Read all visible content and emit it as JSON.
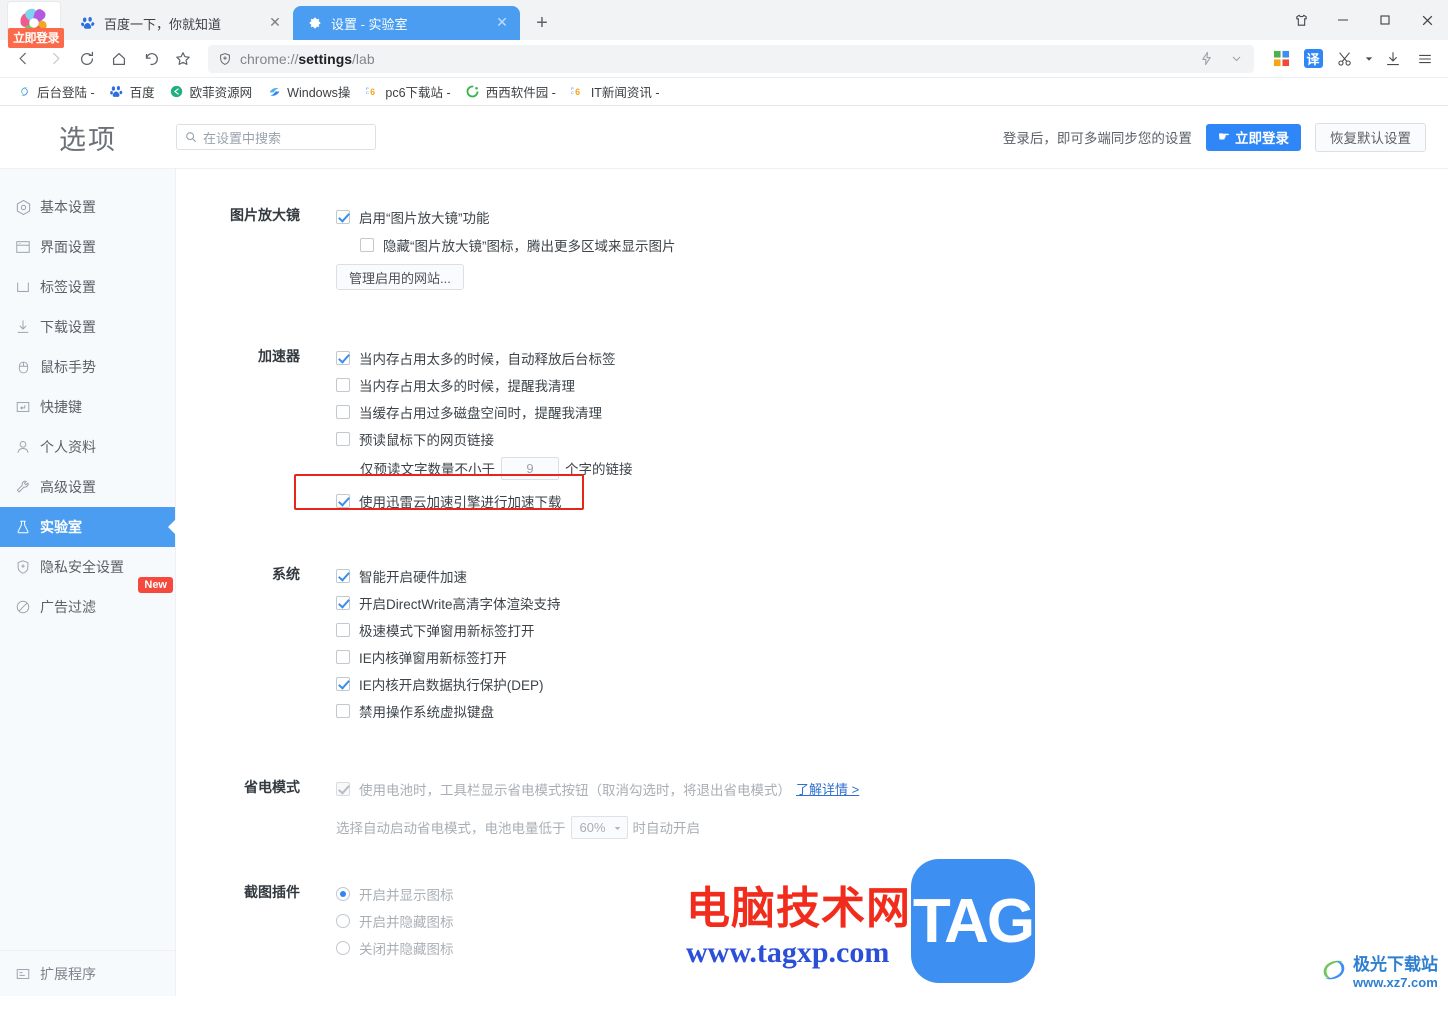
{
  "browser": {
    "login_badge": "立即登录",
    "tabs": [
      {
        "title": "百度一下，你就知道",
        "favicon": "baidu-icon",
        "active": false
      },
      {
        "title": "设置 - 实验室",
        "favicon": "gear-icon",
        "active": true
      }
    ],
    "new_tab_label": "+",
    "window_controls": [
      "skin-icon",
      "minimize-icon",
      "maximize-icon",
      "close-icon"
    ],
    "nav": {
      "back": "back-icon",
      "forward": "forward-icon",
      "reload": "reload-icon",
      "home": "home-icon",
      "undo": "undo-restore-icon",
      "bookmark": "star-icon"
    },
    "address": {
      "prefix": "chrome://",
      "strong": "settings",
      "suffix": "/lab"
    },
    "toolbar_icons": [
      "lightning-icon",
      "chevron-down-icon",
      "windows-apps-icon",
      "translate-icon",
      "scissors-icon",
      "scissors-dropdown-icon",
      "download-icon",
      "menu-icon"
    ],
    "translate_label": "译",
    "bookmarks": [
      {
        "label": "后台登陆 -",
        "icon": "swirl-icon"
      },
      {
        "label": "百度",
        "icon": "baidu-icon"
      },
      {
        "label": "欧菲资源网",
        "icon": "green-circle-icon"
      },
      {
        "label": "Windows操",
        "icon": "windows-site-icon"
      },
      {
        "label": "pc6下载站 -",
        "icon": "pc6-icon"
      },
      {
        "label": "西西软件园 -",
        "icon": "cc-icon"
      },
      {
        "label": "IT新闻资讯 -",
        "icon": "pc6-icon"
      }
    ]
  },
  "settings": {
    "title": "选项",
    "search_placeholder": "在设置中搜索",
    "sync_text": "登录后，即可多端同步您的设置",
    "login_button": "立即登录",
    "reset_button": "恢复默认设置",
    "sidebar": {
      "items": [
        {
          "label": "基本设置",
          "icon": "target-icon",
          "active": false
        },
        {
          "label": "界面设置",
          "icon": "window-icon",
          "active": false
        },
        {
          "label": "标签设置",
          "icon": "tab-icon",
          "active": false
        },
        {
          "label": "下载设置",
          "icon": "download-icon",
          "active": false
        },
        {
          "label": "鼠标手势",
          "icon": "mouse-icon",
          "active": false
        },
        {
          "label": "快捷键",
          "icon": "keyboard-icon",
          "active": false
        },
        {
          "label": "个人资料",
          "icon": "user-icon",
          "active": false
        },
        {
          "label": "高级设置",
          "icon": "wrench-icon",
          "active": false
        },
        {
          "label": "实验室",
          "icon": "flask-icon",
          "active": true
        },
        {
          "label": "隐私安全设置",
          "icon": "shield-icon",
          "active": false
        },
        {
          "label": "广告过滤",
          "icon": "block-icon",
          "active": false
        }
      ],
      "new_badge": "New",
      "bottom_item": {
        "label": "扩展程序",
        "icon": "extension-icon"
      }
    },
    "sections": [
      {
        "title": "图片放大镜",
        "rows": [
          {
            "type": "checkbox",
            "checked": true,
            "label": "启用“图片放大镜”功能"
          },
          {
            "type": "checkbox",
            "checked": false,
            "indent": true,
            "label": "隐藏“图片放大镜”图标，腾出更多区域来显示图片"
          },
          {
            "type": "button",
            "indent": false,
            "label": "管理启用的网站..."
          }
        ]
      },
      {
        "title": "加速器",
        "rows": [
          {
            "type": "checkbox",
            "checked": true,
            "label": "当内存占用太多的时候，自动释放后台标签"
          },
          {
            "type": "checkbox",
            "checked": false,
            "label": "当内存占用太多的时候，提醒我清理"
          },
          {
            "type": "checkbox",
            "checked": false,
            "label": "当缓存占用过多磁盘空间时，提醒我清理"
          },
          {
            "type": "checkbox",
            "checked": false,
            "label": "预读鼠标下的网页链接"
          },
          {
            "type": "number",
            "indent": true,
            "pre_label": "仅预读文字数量不小于",
            "value": "9",
            "post_label": "个字的链接"
          },
          {
            "type": "checkbox",
            "checked": true,
            "gray": true,
            "highlighted": true,
            "label": "使用迅雷云加速引擎进行加速下载"
          }
        ]
      },
      {
        "title": "系统",
        "rows": [
          {
            "type": "checkbox",
            "checked": true,
            "gray": true,
            "label": "智能开启硬件加速"
          },
          {
            "type": "checkbox",
            "checked": true,
            "gray": true,
            "label": "开启DirectWrite高清字体渲染支持"
          },
          {
            "type": "checkbox",
            "checked": false,
            "label": "极速模式下弹窗用新标签打开"
          },
          {
            "type": "checkbox",
            "checked": false,
            "label": "IE内核弹窗用新标签打开"
          },
          {
            "type": "checkbox",
            "checked": true,
            "label": "IE内核开启数据执行保护(DEP)"
          },
          {
            "type": "checkbox",
            "checked": false,
            "label": "禁用操作系统虚拟键盘"
          }
        ]
      },
      {
        "title": "省电模式",
        "disabled": true,
        "rows": [
          {
            "type": "checkbox",
            "checked": true,
            "disabled": true,
            "label": "使用电池时，工具栏显示省电模式按钮（取消勾选时，将退出省电模式）",
            "link": "了解详情 >"
          },
          {
            "type": "select",
            "indent": true,
            "disabled": true,
            "pre_label": "选择自动启动省电模式，电池电量低于",
            "value": "60%",
            "post_label": "时自动开启"
          }
        ]
      },
      {
        "title": "截图插件",
        "rows": [
          {
            "type": "radio",
            "checked": true,
            "label": "开启并显示图标"
          },
          {
            "type": "radio",
            "checked": false,
            "label": "开启并隐藏图标"
          },
          {
            "type": "radio",
            "checked": false,
            "label": "关闭并隐藏图标"
          }
        ]
      }
    ]
  },
  "watermarks": {
    "tag_cn": "电脑技术网",
    "tag_url": "www.tagxp.com",
    "tag_square": "TAG",
    "jg_name": "极光下载站",
    "jg_url": "www.xz7.com"
  }
}
